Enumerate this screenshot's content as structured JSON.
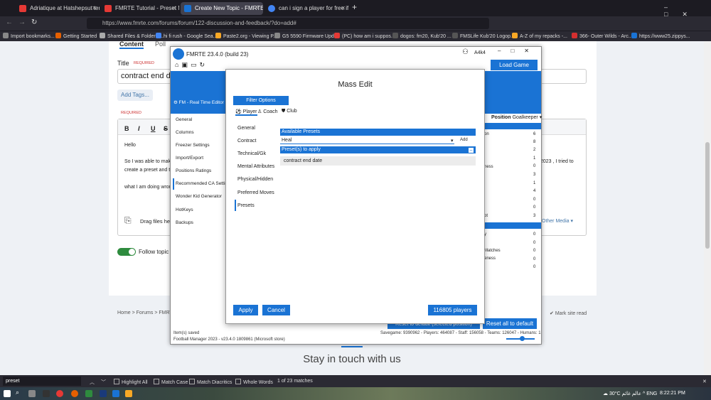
{
  "browser": {
    "tabs": [
      {
        "label": "Adriatique at Hatshepsut temp",
        "fav": "#e53935"
      },
      {
        "label": "FMRTE Tutorial - Preset Manag",
        "fav": "#e53935"
      },
      {
        "label": "Create New Topic - FMRTE",
        "fav": "#1a73d4"
      },
      {
        "label": "can i sign a player for free if i h",
        "fav": "#4285f4"
      }
    ],
    "url": "https://www.fmrte.com/forums/forum/122-discussion-and-feedback/?do=add#",
    "bookmarks": [
      "Import bookmarks...",
      "Getting Started",
      "Shared Files & Folders ...",
      "hi fi rush - Google Sea...",
      "Paste2.org - Viewing P...",
      "G5 5590 Firmware Upd...",
      "(PC) how am i suppos...",
      "dogos: fm20, Kub'20 ...",
      "FMSLife Kub'20 Logop...",
      "A-Z of my repacks -...",
      "366- Outer Wilds - Arc...",
      "https://www25.zippys..."
    ]
  },
  "topic": {
    "tab_content": "Content",
    "tab_poll": "Poll",
    "title_label": "Title",
    "required": "REQUIRED",
    "title_value": "contract end date",
    "add_tags": "Add Tags...",
    "editor_lines": [
      "Hello",
      "So I was able to mak",
      "create a preset and t",
      "what I am doing wron"
    ],
    "editor_right_text": "2023 , I tried to",
    "drag_files": "Drag files here",
    "other_media": "Other Media",
    "follow_topic": "Follow topic",
    "breadcrumb": "Home > Forums > FMRT",
    "mark_read": "Mark site read",
    "stay_in_touch": "Stay in touch with us"
  },
  "app": {
    "title": "FMRTE 23.4.0 (build 23)",
    "user": "A4k4",
    "load_game": "Load Game",
    "sidebar_header": "FM - Real Time Editor",
    "sidebar": [
      "General",
      "Columns",
      "Freezer Settings",
      "Import/Export",
      "Positions Ratings",
      "Recommended CA Settin",
      "Wonder Kid Generator",
      "HotKeys",
      "Backups"
    ],
    "position_label": "Position",
    "position_value": "Goalkeeper",
    "right_labels": [
      "on",
      "ness",
      "ot",
      "y",
      "Matches",
      "eness"
    ],
    "right_values": [
      "6",
      "8",
      "2",
      "1",
      "0",
      "3",
      "1",
      "4",
      "0",
      "0",
      "3",
      "0",
      "0",
      "0",
      "0",
      "0"
    ],
    "reset_selected": "Reset to default (selected position)",
    "reset_all": "Reset all to default",
    "status_saved": "Item(s) saved",
    "status_version": "Football Manager 2023 - v23.4.0 1809861 (Microsoft store)",
    "status_counts": "Savegame: 9390962 - Players: 464087 - Staff: 156058 - Teams: 126047 - Humans: 1"
  },
  "dialog": {
    "title": "Mass Edit",
    "filter_options": "Filter Options",
    "tabs": [
      "Player",
      "Coach",
      "Club"
    ],
    "categories": [
      "General",
      "Contract",
      "Technical/Gk",
      "Mental Attributes",
      "Physical/Hidden",
      "Preferred Moves",
      "Presets"
    ],
    "available_presets": "Available Presets",
    "preset_input": "Heal",
    "add": "Add",
    "presets_to_apply": "Preset(s) to apply",
    "preset_item": "contract end date",
    "apply": "Apply",
    "cancel": "Cancel",
    "players_count": "116805 players"
  },
  "findbar": {
    "query": "preset",
    "highlight_all": "Highlight All",
    "match_case": "Match Case",
    "match_diacritics": "Match Diacritics",
    "whole_words": "Whole Words",
    "matches": "1 of 23 matches"
  },
  "taskbar": {
    "weather": "30°C",
    "tray_text": "عالم غائم",
    "lang": "ENG",
    "time": "8:22:21 PM"
  }
}
